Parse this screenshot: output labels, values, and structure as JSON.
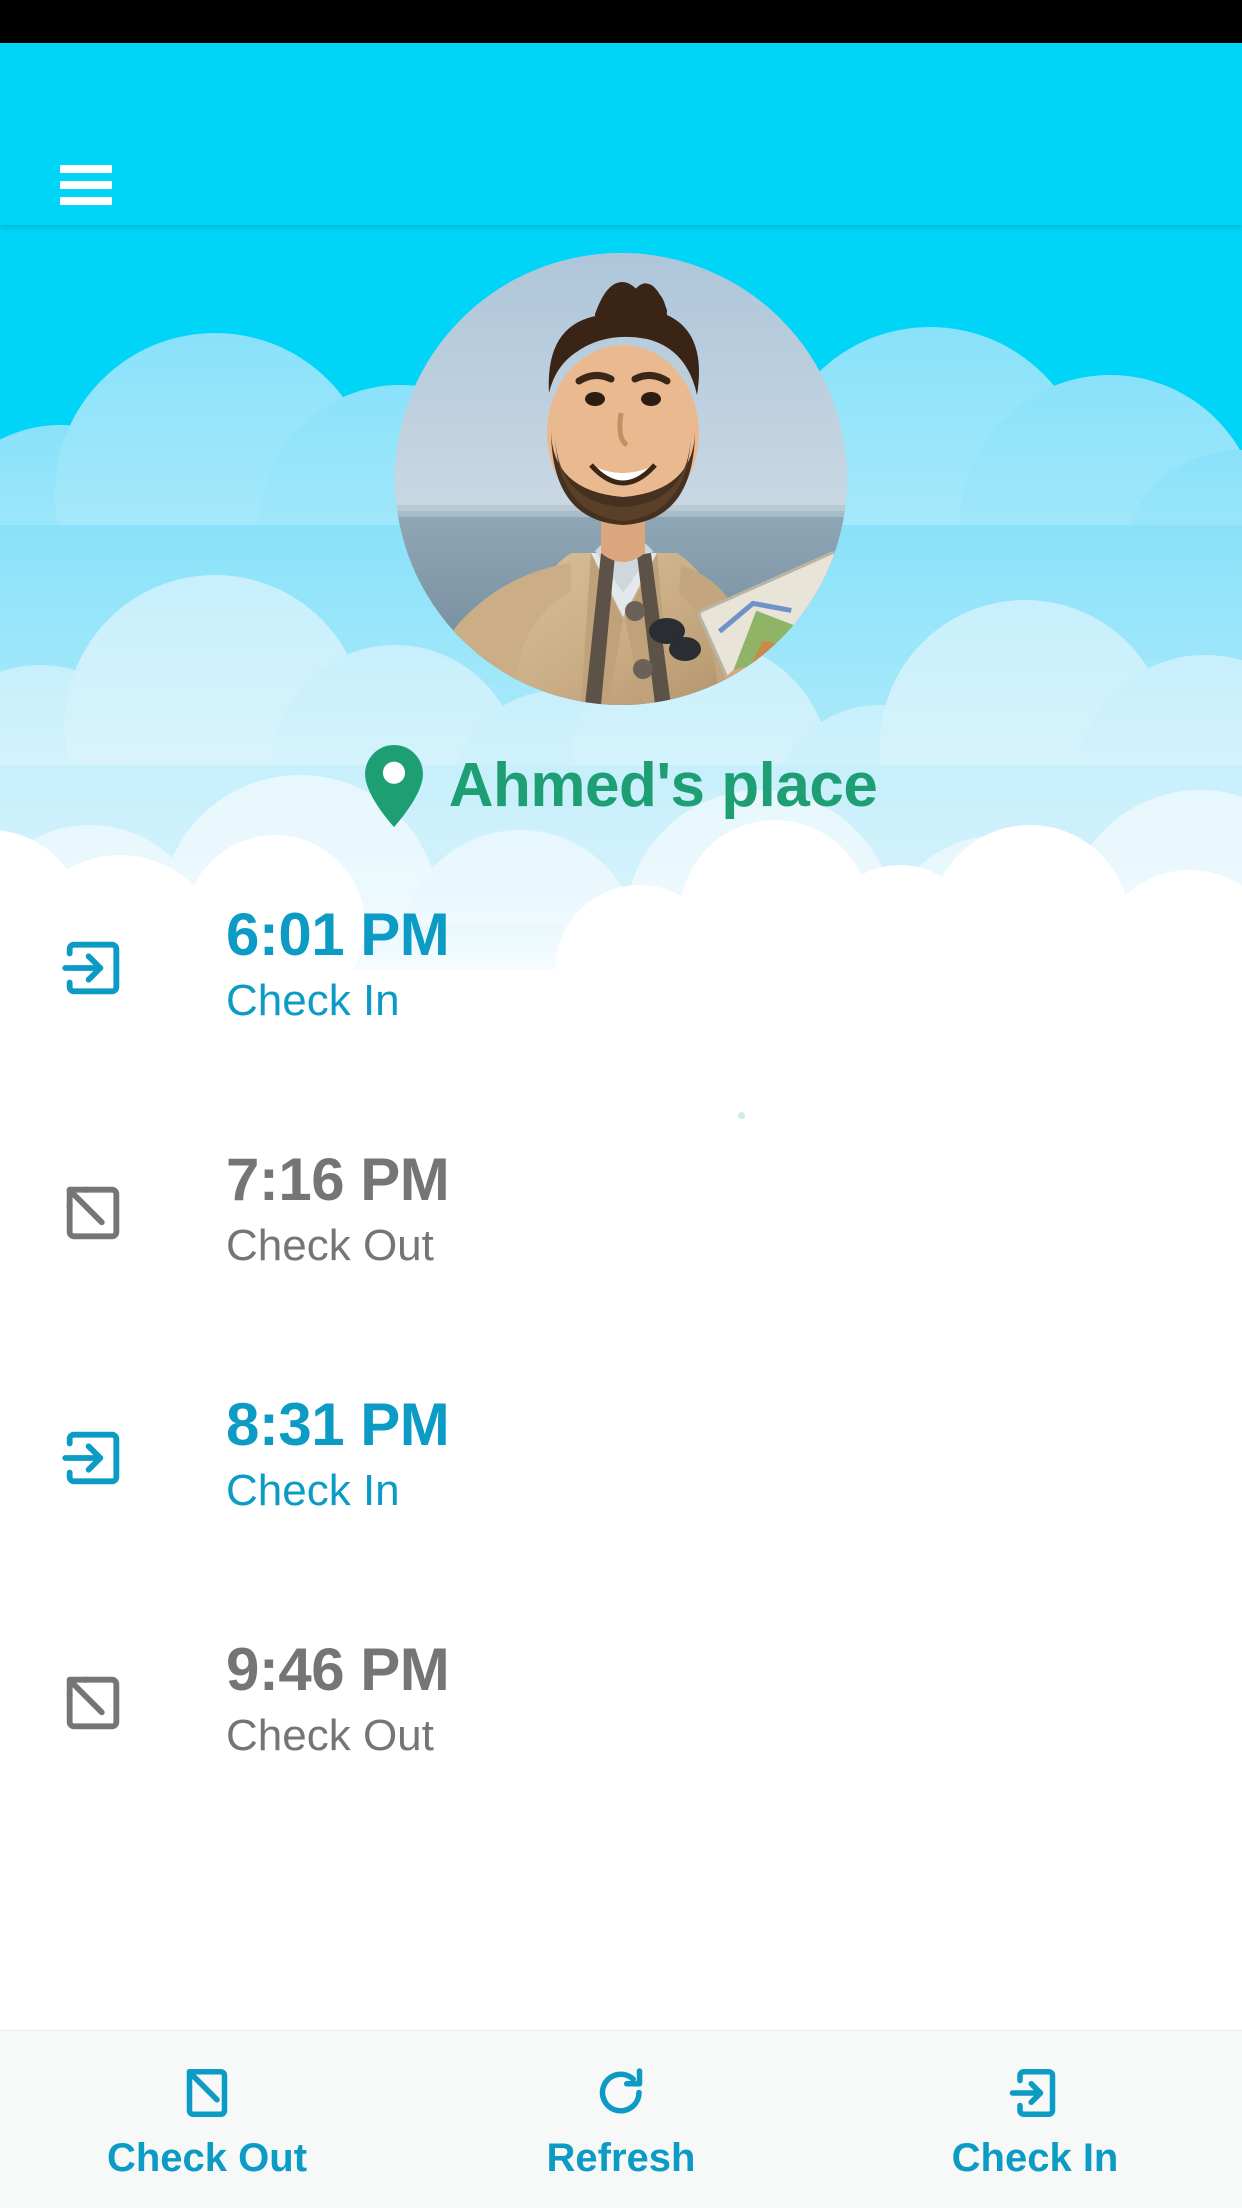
{
  "theme": {
    "sky": "#00d4f7",
    "app_bar": "#00d4f7",
    "check_in_color": "#0c9bc4",
    "check_out_color": "#757575",
    "place_color": "#1e9e73",
    "bottom_bar_bg": "#f7f8f8",
    "status_bar": "#000000"
  },
  "app_bar": {
    "menu_icon": "hamburger-menu-icon"
  },
  "hero": {
    "avatar_icon": "user-avatar-photo",
    "avatar_alt": "Smiling bearded man in tan trench coat holding a map by the sea"
  },
  "place": {
    "pin_icon": "map-pin-icon",
    "name": "Ahmed's place"
  },
  "entries": [
    {
      "time": "6:01 PM",
      "label": "Check In",
      "type": "in",
      "icon": "login-arrow-icon"
    },
    {
      "time": "7:16 PM",
      "label": "Check Out",
      "type": "out",
      "icon": "logout-arrow-icon"
    },
    {
      "time": "8:31 PM",
      "label": "Check In",
      "type": "in",
      "icon": "login-arrow-icon"
    },
    {
      "time": "9:46 PM",
      "label": "Check Out",
      "type": "out",
      "icon": "logout-arrow-icon"
    }
  ],
  "bottom_bar": {
    "items": [
      {
        "label": "Check Out",
        "icon": "logout-arrow-icon"
      },
      {
        "label": "Refresh",
        "icon": "refresh-circular-arrow-icon"
      },
      {
        "label": "Check In",
        "icon": "login-arrow-icon"
      }
    ]
  }
}
